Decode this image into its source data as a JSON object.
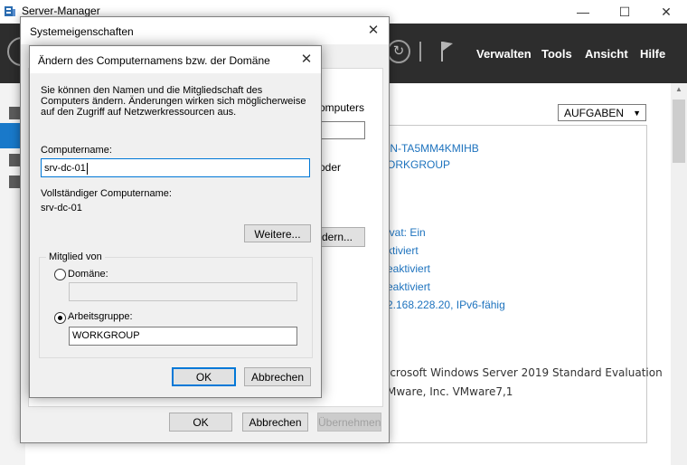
{
  "server_manager": {
    "title": "Server-Manager",
    "menu": [
      "Verwalten",
      "Tools",
      "Ansicht",
      "Hilfe"
    ],
    "window_controls": {
      "minimize": "—",
      "maximize": "☐",
      "close": "✕"
    },
    "tasks_button": "AUFGABEN",
    "properties": {
      "computer_name": "IN-TA5MM4KMIHB",
      "workgroup": "ORKGROUP",
      "firewall": "ivat: Ein",
      "remote_mgmt": "ktiviert",
      "remote_desktop": "eaktiviert",
      "nic_teaming": "eaktiviert",
      "ethernet": "2.168.228.20, IPv6-fähig",
      "os": "icrosoft Windows Server 2019 Standard Evaluation",
      "hardware": "Mware, Inc. VMware7,1"
    }
  },
  "system_properties": {
    "title": "Systemeigenschaften",
    "close": "✕",
    "ghost_text_1": "omputers",
    "ghost_text_2": "oder",
    "ghost_button": "dern...",
    "ok": "OK",
    "cancel": "Abbrechen",
    "apply": "Übernehmen"
  },
  "change_name_dialog": {
    "title": "Ändern des Computernamens bzw. der Domäne",
    "close": "✕",
    "description": "Sie können den Namen und die Mitgliedschaft des Computers ändern. Änderungen wirken sich möglicherweise auf den Zugriff auf Netzwerkressourcen aus.",
    "computer_name_label": "Computername:",
    "computer_name_value": "srv-dc-01",
    "full_name_label": "Vollständiger Computername:",
    "full_name_value": "srv-dc-01",
    "more_button": "Weitere...",
    "member_of_label": "Mitglied von",
    "domain_label": "Domäne:",
    "domain_value": "",
    "workgroup_label": "Arbeitsgruppe:",
    "workgroup_value": "WORKGROUP",
    "selected_membership": "workgroup",
    "ok": "OK",
    "cancel": "Abbrechen"
  }
}
